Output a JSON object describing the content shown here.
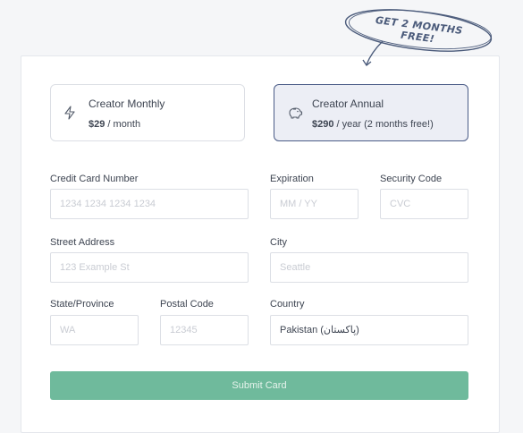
{
  "promo": {
    "text": "GET 2 MONTHS FREE!"
  },
  "plans": [
    {
      "name": "Creator Monthly",
      "price": "$29",
      "suffix": " / month",
      "icon": "lightning-icon",
      "selected": false
    },
    {
      "name": "Creator Annual",
      "price": "$290",
      "suffix": " / year (2 months free!)",
      "icon": "piggy-bank-icon",
      "selected": true
    }
  ],
  "form": {
    "card_number": {
      "label": "Credit Card Number",
      "placeholder": "1234 1234 1234 1234"
    },
    "expiration": {
      "label": "Expiration",
      "placeholder": "MM / YY"
    },
    "security_code": {
      "label": "Security Code",
      "placeholder": "CVC"
    },
    "street": {
      "label": "Street Address",
      "placeholder": "123 Example St"
    },
    "city": {
      "label": "City",
      "placeholder": "Seattle"
    },
    "state": {
      "label": "State/Province",
      "placeholder": "WA"
    },
    "postal": {
      "label": "Postal Code",
      "placeholder": "12345"
    },
    "country": {
      "label": "Country",
      "value": "Pakistan (پاکستان)"
    },
    "submit_label": "Submit Card"
  },
  "colors": {
    "accent": "#4b5c87",
    "submit": "#6fba9c",
    "selected_bg": "#eceef5"
  }
}
